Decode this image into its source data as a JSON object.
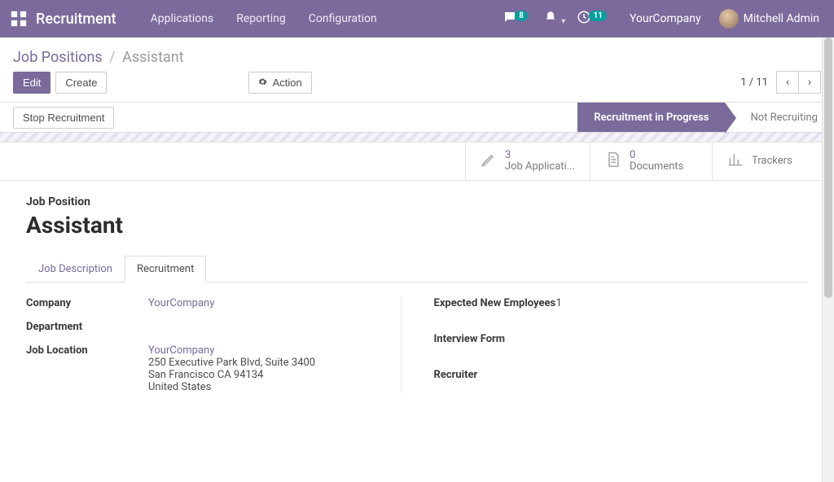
{
  "topbar": {
    "brand": "Recruitment",
    "nav": [
      "Applications",
      "Reporting",
      "Configuration"
    ],
    "messages_badge": "8",
    "activities_badge": "11",
    "company": "YourCompany",
    "user": "Mitchell Admin"
  },
  "breadcrumbs": {
    "root": "Job Positions",
    "current": "Assistant"
  },
  "toolbar": {
    "edit": "Edit",
    "create": "Create",
    "action": "Action",
    "pager": "1 / 11"
  },
  "status_bar": {
    "stop_btn": "Stop Recruitment",
    "current_stage": "Recruitment in Progress",
    "other_stage": "Not Recruiting"
  },
  "stat_buttons": {
    "apps_count": "3",
    "apps_label": "Job Applicati...",
    "docs_count": "0",
    "docs_label": "Documents",
    "trackers_label": "Trackers"
  },
  "form": {
    "section_label": "Job Position",
    "title": "Assistant",
    "tabs": {
      "desc": "Job Description",
      "recruit": "Recruitment"
    },
    "labels": {
      "company": "Company",
      "department": "Department",
      "job_location": "Job Location",
      "expected_new": "Expected New Employees",
      "interview_form": "Interview Form",
      "recruiter": "Recruiter"
    },
    "values": {
      "company": "YourCompany",
      "location_name": "YourCompany",
      "street": "250 Executive Park Blvd, Suite 3400",
      "city_state_zip": "San Francisco CA 94134",
      "country": "United States",
      "expected_new": "1"
    }
  }
}
